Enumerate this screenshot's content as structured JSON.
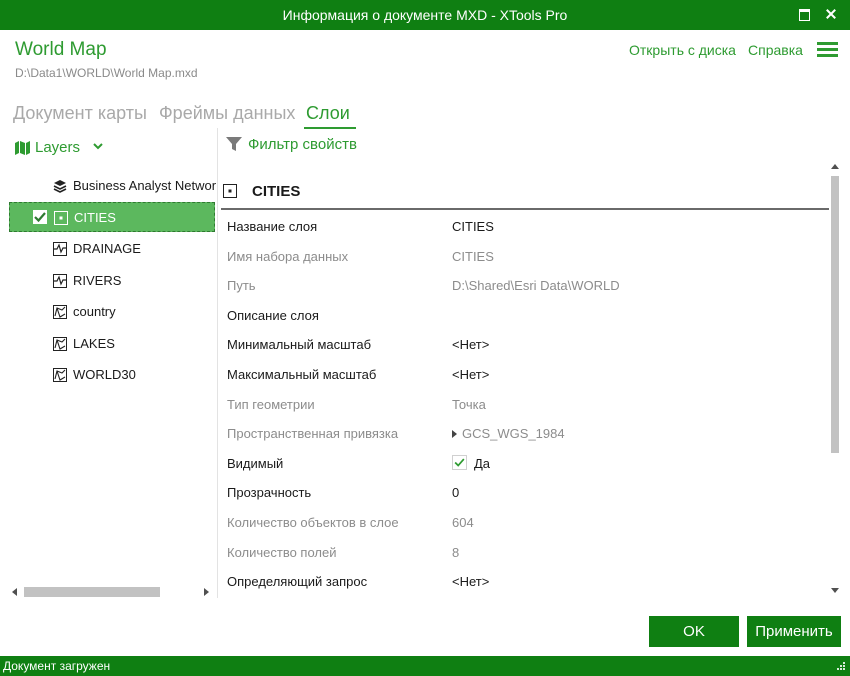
{
  "window": {
    "title": "Информация о документе MXD - XTools Pro"
  },
  "header": {
    "title": "World Map",
    "path": "D:\\Data1\\WORLD\\World Map.mxd",
    "open_from_disk": "Открыть с диска",
    "help": "Справка"
  },
  "tabs": [
    {
      "label": "Документ карты",
      "active": false
    },
    {
      "label": "Фреймы данных",
      "active": false
    },
    {
      "label": "Слои",
      "active": true
    }
  ],
  "layers_panel": {
    "title": "Layers",
    "items": [
      {
        "name": "Business Analyst Network",
        "icon": "layer-stack-icon",
        "selected": false
      },
      {
        "name": "CITIES",
        "icon": "point-layer-icon",
        "selected": true,
        "checked": true
      },
      {
        "name": "DRAINAGE",
        "icon": "line-layer-icon",
        "selected": false
      },
      {
        "name": "RIVERS",
        "icon": "line-layer-icon",
        "selected": false
      },
      {
        "name": "country",
        "icon": "polygon-layer-icon",
        "selected": false
      },
      {
        "name": "LAKES",
        "icon": "polygon-layer-icon",
        "selected": false
      },
      {
        "name": "WORLD30",
        "icon": "polygon-layer-icon",
        "selected": false
      }
    ]
  },
  "properties": {
    "filter_label": "Фильтр свойств",
    "layer_title": "CITIES",
    "rows": [
      {
        "key": "Название слоя",
        "value": "CITIES",
        "dim": false
      },
      {
        "key": "Имя набора данных",
        "value": "CITIES",
        "dim": true
      },
      {
        "key": "Путь",
        "value": "D:\\Shared\\Esri Data\\WORLD",
        "dim": true
      },
      {
        "key": "Описание слоя",
        "value": "",
        "dim": false
      },
      {
        "key": "Минимальный масштаб",
        "value": "<Нет>",
        "dim": false
      },
      {
        "key": "Максимальный масштаб",
        "value": "<Нет>",
        "dim": false
      },
      {
        "key": "Тип геометрии",
        "value": "Точка",
        "dim": true
      },
      {
        "key": "Пространственная привязка",
        "value": "GCS_WGS_1984",
        "dim": true,
        "expandable": true
      },
      {
        "key": "Видимый",
        "value": "Да",
        "dim": false,
        "checkbox": true,
        "checked": true
      },
      {
        "key": "Прозрачность",
        "value": "0",
        "dim": false
      },
      {
        "key": "Количество объектов в слое",
        "value": "604",
        "dim": true
      },
      {
        "key": "Количество полей",
        "value": "8",
        "dim": true
      },
      {
        "key": "Определяющий запрос",
        "value": "<Нет>",
        "dim": false
      }
    ]
  },
  "buttons": {
    "ok": "OK",
    "apply": "Применить"
  },
  "status": {
    "text": "Документ загружен"
  },
  "colors": {
    "brand_green": "#0f7f12",
    "accent_green": "#2e9b31",
    "selection_green": "#5cb85e",
    "dim_text": "#8c8c8c"
  }
}
